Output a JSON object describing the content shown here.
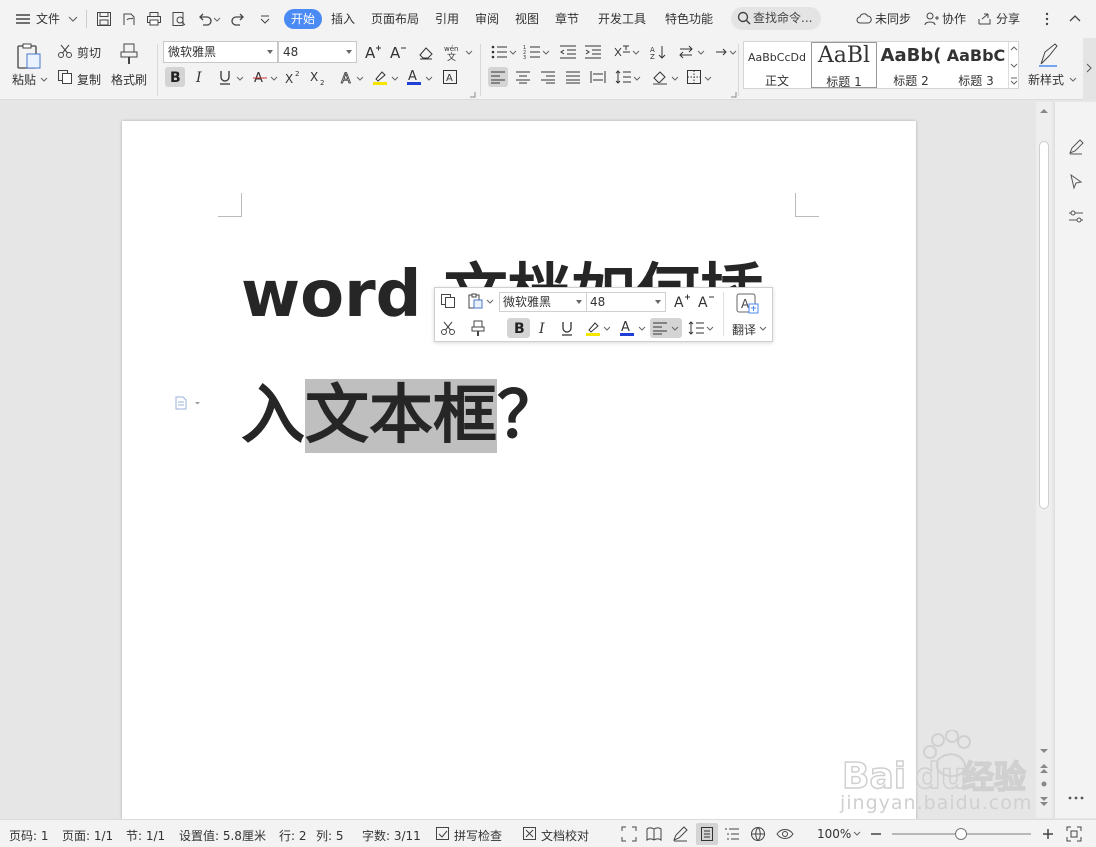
{
  "menu": {
    "file_label": "文件",
    "tabs": [
      "开始",
      "插入",
      "页面布局",
      "引用",
      "审阅",
      "视图",
      "章节",
      "开发工具",
      "特色功能"
    ],
    "search_label": "查找命令...",
    "sync_label": "未同步",
    "collab_label": "协作",
    "share_label": "分享"
  },
  "ribbon": {
    "paste_label": "粘贴",
    "cut_label": "剪切",
    "copy_label": "复制",
    "format_painter_label": "格式刷",
    "font_name": "微软雅黑",
    "font_size": "48",
    "new_style_label": "新样式",
    "styles": [
      {
        "preview": "AaBbCcDd",
        "name": "正文"
      },
      {
        "preview": "AaBl",
        "name": "标题 1"
      },
      {
        "preview": "AaBb(",
        "name": "标题 2"
      },
      {
        "preview": "AaBbC",
        "name": "标题 3"
      }
    ]
  },
  "document": {
    "line1": "word 文档如何插",
    "line2_prefix": "入",
    "line2_selected": "文本框",
    "line2_suffix": "？"
  },
  "mini_toolbar": {
    "font_name": "微软雅黑",
    "font_size": "48",
    "translate_label": "翻译"
  },
  "status": {
    "page_no": "页码: 1",
    "pages": "页面: 1/1",
    "section": "节: 1/1",
    "setting": "设置值: 5.8厘米",
    "row": "行: 2",
    "col": "列: 5",
    "word_count": "字数: 3/11",
    "spell_check": "拼写检查",
    "doc_proof": "文档校对",
    "zoom": "100%"
  },
  "watermark": {
    "brand": "Baidu经验",
    "url": "jingyan.baidu.com"
  },
  "colors": {
    "accent": "#4a8af4",
    "selection": "#bfbfbf",
    "highlight_yellow": "#f5e600",
    "font_color_blue": "#1f3fd6"
  }
}
